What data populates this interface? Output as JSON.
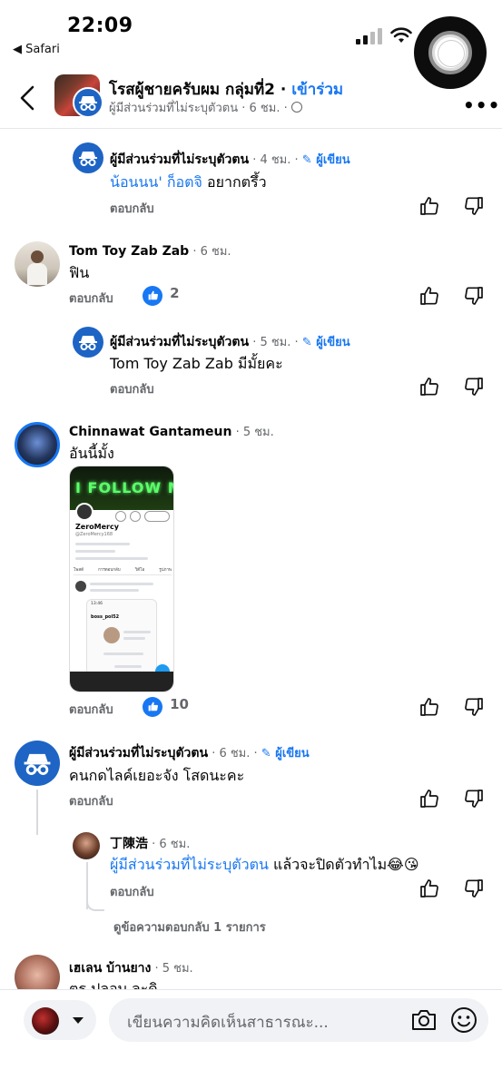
{
  "status_bar": {
    "time": "22:09",
    "back_app": "◀ Safari"
  },
  "header": {
    "group_title": "โรสผู้ชายครับผม กลุ่มที่2",
    "separator": " · ",
    "join_label": "เข้าร่วม",
    "subtitle": "ผู้มีส่วนร่วมที่ไม่ระบุตัวตน · 6 ชม. · "
  },
  "comments": [
    {
      "name": "ผู้มีส่วนร่วมที่ไม่ระบุตัวตน",
      "time": " · 4 ชม. · ",
      "author_badge": "ผู้เขียน",
      "mention": "น้อนนน' ก็อตจิ",
      "text": " อยากตรึ้ว",
      "reply": "ตอบกลับ"
    },
    {
      "name": "Tom Toy Zab Zab",
      "time": " · 6 ชม.",
      "text": "ฟิน",
      "reply": "ตอบกลับ",
      "likes": "2"
    },
    {
      "name": "ผู้มีส่วนร่วมที่ไม่ระบุตัวตน",
      "time": " · 5 ชม. · ",
      "author_badge": "ผู้เขียน",
      "text": "Tom Toy Zab Zab มีมั้ยคะ",
      "reply": "ตอบกลับ"
    },
    {
      "name": "Chinnawat Gantameun",
      "time": " · 5 ชม.",
      "text": "อันนี้มั้ง",
      "reply": "ตอบกลับ",
      "likes": "10",
      "attachment": {
        "banner": "I FOLLOW ME!",
        "profile_name": "ZeroMercy",
        "handle": "@ZeroMercy168",
        "tabs": [
          "โพสต์",
          "การตอบกลับ",
          "วิดีโอ",
          "รูปภาพ"
        ],
        "inner_handle": "boss_pol52",
        "clock": "13:46"
      }
    },
    {
      "name": "ผู้มีส่วนร่วมที่ไม่ระบุตัวตน",
      "time": " · 6 ชม. · ",
      "author_badge": "ผู้เขียน",
      "text": "คนกดไลค์เยอะจัง โสดนะคะ",
      "reply": "ตอบกลับ"
    },
    {
      "name": "丁陳浩",
      "time": " · 6 ชม.",
      "mention": "ผู้มีส่วนร่วมที่ไม่ระบุตัวตน",
      "text": " แล้วจะปิดตัวทำไม😂😘",
      "reply": "ตอบกลับ"
    },
    {
      "view_replies": "ดูข้อความตอบกลับ 1 รายการ"
    },
    {
      "name": "เฮเลน บ้านยาง",
      "time": " · 5 ชม.",
      "text": "ตร ปลอบ ละดิ"
    }
  ],
  "composer": {
    "placeholder": "เขียนความคิดเห็นสาธารณะ..."
  },
  "colors": {
    "accent": "#1877f2",
    "anon_avatar": "#1d64c4",
    "muted": "#65676b"
  }
}
